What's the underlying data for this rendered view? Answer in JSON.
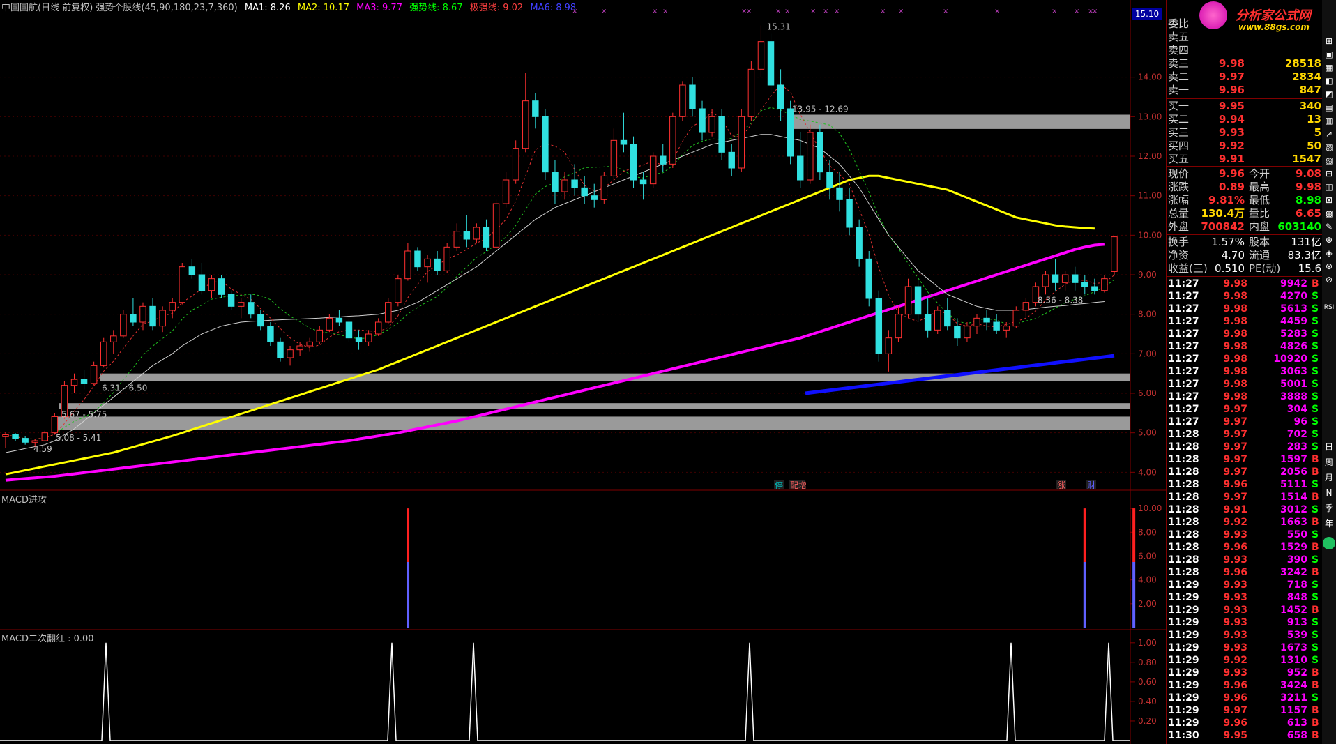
{
  "header": {
    "title": "中国国航(日线 前复权) 强势个股线(45,90,180,23,7,360)",
    "ma1": "MA1: 8.26",
    "ma2": "MA2: 10.17",
    "ma3": "MA3: 9.77",
    "qsx": "强势线: 8.67",
    "jqx": "极强线: 9.02",
    "ma6": "MA6: 8.98",
    "colors": {
      "title": "#c0c0c0",
      "ma1": "#ffffff",
      "ma2": "#ffff00",
      "ma3": "#ff00ff",
      "qsx": "#00ff00",
      "jqx": "#ff4040",
      "ma6": "#0000ff"
    }
  },
  "price_axis": {
    "current_box": "15.10",
    "ticks": [
      "14.00",
      "13.00",
      "12.00",
      "11.00",
      "10.00",
      "9.00",
      "8.00",
      "7.00",
      "6.00",
      "5.00",
      "4.00"
    ]
  },
  "annotations": {
    "high": "15.31",
    "low": "4.59",
    "zone1": "13.95 - 12.69",
    "zone2": "6.31 - 6.50",
    "zone3": "5.67 - 5.75",
    "zone4": "5.08 - 5.41",
    "zone5": "8.36 - 8.38"
  },
  "event_tags": [
    "停",
    "配增",
    "涨",
    "财"
  ],
  "macd_panel": {
    "title": "MACD进攻",
    "ticks": [
      "10.00",
      "8.00",
      "6.00",
      "4.00",
      "2.00"
    ]
  },
  "macd2_panel": {
    "title": "MACD二次翻红 : 0.00",
    "ticks": [
      "1.00",
      "0.80",
      "0.60",
      "0.40",
      "0.20"
    ]
  },
  "logo": {
    "text": "分析家公式网",
    "url": "www.88gs.com"
  },
  "order_book": {
    "weibi": "委比",
    "asks": [
      {
        "label": "卖五",
        "price": "",
        "vol": ""
      },
      {
        "label": "卖四",
        "price": "",
        "vol": ""
      },
      {
        "label": "卖三",
        "price": "9.98",
        "vol": "28518"
      },
      {
        "label": "卖二",
        "price": "9.97",
        "vol": "2834"
      },
      {
        "label": "卖一",
        "price": "9.96",
        "vol": "847"
      }
    ],
    "bids": [
      {
        "label": "买一",
        "price": "9.95",
        "vol": "340"
      },
      {
        "label": "买二",
        "price": "9.94",
        "vol": "13"
      },
      {
        "label": "买三",
        "price": "9.93",
        "vol": "5"
      },
      {
        "label": "买四",
        "price": "9.92",
        "vol": "50"
      },
      {
        "label": "买五",
        "price": "9.91",
        "vol": "1547"
      }
    ]
  },
  "quote": [
    {
      "l1": "现价",
      "v1": "9.96",
      "l2": "今开",
      "v2": "9.08"
    },
    {
      "l1": "涨跌",
      "v1": "0.89",
      "l2": "最高",
      "v2": "9.98"
    },
    {
      "l1": "涨幅",
      "v1": "9.81%",
      "l2": "最低",
      "v2": "8.98"
    },
    {
      "l1": "总量",
      "v1": "130.4万",
      "l2": "量比",
      "v2": "6.65"
    },
    {
      "l1": "外盘",
      "v1": "700842",
      "l2": "内盘",
      "v2": "603140"
    }
  ],
  "fundamentals": [
    {
      "l1": "换手",
      "v1": "1.57%",
      "l2": "股本",
      "v2": "131亿"
    },
    {
      "l1": "净资",
      "v1": "4.70",
      "l2": "流通",
      "v2": "83.3亿"
    },
    {
      "l1": "收益(三)",
      "v1": "0.510",
      "l2": "PE(动)",
      "v2": "15.6"
    }
  ],
  "ticks": [
    [
      "11:27",
      "9.98",
      "9942",
      "B"
    ],
    [
      "11:27",
      "9.98",
      "4270",
      "S"
    ],
    [
      "11:27",
      "9.98",
      "5613",
      "S"
    ],
    [
      "11:27",
      "9.98",
      "4459",
      "S"
    ],
    [
      "11:27",
      "9.98",
      "5283",
      "S"
    ],
    [
      "11:27",
      "9.98",
      "4826",
      "S"
    ],
    [
      "11:27",
      "9.98",
      "10920",
      "S"
    ],
    [
      "11:27",
      "9.98",
      "3063",
      "S"
    ],
    [
      "11:27",
      "9.98",
      "5001",
      "S"
    ],
    [
      "11:27",
      "9.98",
      "3888",
      "S"
    ],
    [
      "11:27",
      "9.97",
      "304",
      "S"
    ],
    [
      "11:27",
      "9.97",
      "96",
      "S"
    ],
    [
      "11:28",
      "9.97",
      "702",
      "S"
    ],
    [
      "11:28",
      "9.97",
      "283",
      "S"
    ],
    [
      "11:28",
      "9.97",
      "1597",
      "B"
    ],
    [
      "11:28",
      "9.97",
      "2056",
      "B"
    ],
    [
      "11:28",
      "9.96",
      "5111",
      "S"
    ],
    [
      "11:28",
      "9.97",
      "1514",
      "B"
    ],
    [
      "11:28",
      "9.91",
      "3012",
      "S"
    ],
    [
      "11:28",
      "9.92",
      "1663",
      "B"
    ],
    [
      "11:28",
      "9.93",
      "550",
      "S"
    ],
    [
      "11:28",
      "9.96",
      "1529",
      "B"
    ],
    [
      "11:28",
      "9.93",
      "390",
      "S"
    ],
    [
      "11:28",
      "9.96",
      "3242",
      "B"
    ],
    [
      "11:29",
      "9.93",
      "718",
      "S"
    ],
    [
      "11:29",
      "9.93",
      "848",
      "S"
    ],
    [
      "11:29",
      "9.93",
      "1452",
      "B"
    ],
    [
      "11:29",
      "9.93",
      "913",
      "S"
    ],
    [
      "11:29",
      "9.93",
      "539",
      "S"
    ],
    [
      "11:29",
      "9.93",
      "1673",
      "S"
    ],
    [
      "11:29",
      "9.92",
      "1310",
      "S"
    ],
    [
      "11:29",
      "9.93",
      "952",
      "B"
    ],
    [
      "11:29",
      "9.96",
      "3424",
      "B"
    ],
    [
      "11:29",
      "9.96",
      "3211",
      "S"
    ],
    [
      "11:29",
      "9.97",
      "1157",
      "B"
    ],
    [
      "11:29",
      "9.96",
      "613",
      "B"
    ],
    [
      "11:30",
      "9.95",
      "658",
      "B"
    ]
  ],
  "sidebar_icons": [
    "日",
    "周",
    "月",
    "N",
    "季",
    "年"
  ],
  "chart_data": {
    "type": "line",
    "title": "中国国航(日线 前复权)",
    "ylim": [
      3.6,
      15.6
    ],
    "candles": [
      [
        4.9,
        5.02,
        4.62,
        4.95
      ],
      [
        4.95,
        4.99,
        4.8,
        4.85
      ],
      [
        4.86,
        4.92,
        4.7,
        4.76
      ],
      [
        4.76,
        4.85,
        4.65,
        4.8
      ],
      [
        4.8,
        5.05,
        4.78,
        5.0
      ],
      [
        5.0,
        5.5,
        4.95,
        5.41
      ],
      [
        5.41,
        6.3,
        5.35,
        6.2
      ],
      [
        6.2,
        6.5,
        6.0,
        6.35
      ],
      [
        6.35,
        6.6,
        6.1,
        6.25
      ],
      [
        6.25,
        6.8,
        6.2,
        6.7
      ],
      [
        6.7,
        7.4,
        6.65,
        7.3
      ],
      [
        7.3,
        7.6,
        7.0,
        7.45
      ],
      [
        7.45,
        8.1,
        7.4,
        8.0
      ],
      [
        8.0,
        8.4,
        7.7,
        7.8
      ],
      [
        7.8,
        8.3,
        7.6,
        8.2
      ],
      [
        8.2,
        8.4,
        7.6,
        7.7
      ],
      [
        7.7,
        8.2,
        7.55,
        8.1
      ],
      [
        8.1,
        8.4,
        7.9,
        8.3
      ],
      [
        8.3,
        9.3,
        8.25,
        9.2
      ],
      [
        9.2,
        9.4,
        8.9,
        9.0
      ],
      [
        9.0,
        9.3,
        8.5,
        8.6
      ],
      [
        8.6,
        9.0,
        8.4,
        8.9
      ],
      [
        8.9,
        9.0,
        8.4,
        8.5
      ],
      [
        8.5,
        8.6,
        8.1,
        8.2
      ],
      [
        8.2,
        8.4,
        7.9,
        8.3
      ],
      [
        8.3,
        8.5,
        7.9,
        8.0
      ],
      [
        8.0,
        8.1,
        7.6,
        7.7
      ],
      [
        7.7,
        7.8,
        7.2,
        7.3
      ],
      [
        7.3,
        7.4,
        6.8,
        6.9
      ],
      [
        6.9,
        7.2,
        6.7,
        7.1
      ],
      [
        7.1,
        7.3,
        6.95,
        7.2
      ],
      [
        7.2,
        7.4,
        7.05,
        7.3
      ],
      [
        7.3,
        7.7,
        7.25,
        7.6
      ],
      [
        7.6,
        8.0,
        7.55,
        7.9
      ],
      [
        7.9,
        8.1,
        7.7,
        7.8
      ],
      [
        7.8,
        7.9,
        7.3,
        7.4
      ],
      [
        7.4,
        7.6,
        7.1,
        7.3
      ],
      [
        7.3,
        7.6,
        7.2,
        7.5
      ],
      [
        7.5,
        7.9,
        7.45,
        7.8
      ],
      [
        7.8,
        8.4,
        7.75,
        8.3
      ],
      [
        8.3,
        9.0,
        8.2,
        8.9
      ],
      [
        8.9,
        9.8,
        8.85,
        9.6
      ],
      [
        9.6,
        9.7,
        9.1,
        9.2
      ],
      [
        9.2,
        9.5,
        8.8,
        9.4
      ],
      [
        9.4,
        9.6,
        9.0,
        9.1
      ],
      [
        9.1,
        9.8,
        9.05,
        9.7
      ],
      [
        9.7,
        10.3,
        9.6,
        10.1
      ],
      [
        10.1,
        10.5,
        9.7,
        9.9
      ],
      [
        9.9,
        10.3,
        9.8,
        10.2
      ],
      [
        10.2,
        10.4,
        9.6,
        9.7
      ],
      [
        9.7,
        10.9,
        9.65,
        10.8
      ],
      [
        10.8,
        11.6,
        10.7,
        11.4
      ],
      [
        11.4,
        12.4,
        11.3,
        12.2
      ],
      [
        12.2,
        14.1,
        12.1,
        13.4
      ],
      [
        13.4,
        13.6,
        12.7,
        13.0
      ],
      [
        13.0,
        13.2,
        11.4,
        11.6
      ],
      [
        11.6,
        11.9,
        10.8,
        11.1
      ],
      [
        11.1,
        11.6,
        10.9,
        11.4
      ],
      [
        11.4,
        11.8,
        11.0,
        11.2
      ],
      [
        11.2,
        11.5,
        10.8,
        11.0
      ],
      [
        11.0,
        11.3,
        10.7,
        10.9
      ],
      [
        10.9,
        11.6,
        10.8,
        11.5
      ],
      [
        11.5,
        12.7,
        11.4,
        12.4
      ],
      [
        12.4,
        13.1,
        12.1,
        12.3
      ],
      [
        12.3,
        12.5,
        11.2,
        11.4
      ],
      [
        11.4,
        11.6,
        10.9,
        11.3
      ],
      [
        11.3,
        12.1,
        11.2,
        12.0
      ],
      [
        12.0,
        12.3,
        11.6,
        11.8
      ],
      [
        11.8,
        13.1,
        11.7,
        13.0
      ],
      [
        13.0,
        13.9,
        12.9,
        13.8
      ],
      [
        13.8,
        14.0,
        13.0,
        13.2
      ],
      [
        13.2,
        13.4,
        12.4,
        12.6
      ],
      [
        12.6,
        13.2,
        12.5,
        13.0
      ],
      [
        13.0,
        13.2,
        11.9,
        12.1
      ],
      [
        12.1,
        12.3,
        11.5,
        11.7
      ],
      [
        11.7,
        13.2,
        11.6,
        13.0
      ],
      [
        13.0,
        14.4,
        12.9,
        14.2
      ],
      [
        14.2,
        15.31,
        14.0,
        14.9
      ],
      [
        14.9,
        15.1,
        13.6,
        13.8
      ],
      [
        13.8,
        14.2,
        12.9,
        13.2
      ],
      [
        13.2,
        13.4,
        11.8,
        12.0
      ],
      [
        12.0,
        12.6,
        11.2,
        11.4
      ],
      [
        11.4,
        12.8,
        11.3,
        12.6
      ],
      [
        12.6,
        12.8,
        11.4,
        11.6
      ],
      [
        11.6,
        11.9,
        10.9,
        11.2
      ],
      [
        11.2,
        11.6,
        10.6,
        10.9
      ],
      [
        10.9,
        11.2,
        10.0,
        10.2
      ],
      [
        10.2,
        10.4,
        9.2,
        9.4
      ],
      [
        9.4,
        9.6,
        8.2,
        8.4
      ],
      [
        8.4,
        8.6,
        6.8,
        7.0
      ],
      [
        7.0,
        7.6,
        6.55,
        7.4
      ],
      [
        7.4,
        8.2,
        7.3,
        8.0
      ],
      [
        8.0,
        8.9,
        7.9,
        8.7
      ],
      [
        8.7,
        8.9,
        7.8,
        8.0
      ],
      [
        8.0,
        8.4,
        7.4,
        7.6
      ],
      [
        7.6,
        8.2,
        7.5,
        8.1
      ],
      [
        8.1,
        8.4,
        7.6,
        7.7
      ],
      [
        7.7,
        7.9,
        7.2,
        7.4
      ],
      [
        7.4,
        7.8,
        7.3,
        7.7
      ],
      [
        7.7,
        8.0,
        7.5,
        7.9
      ],
      [
        7.9,
        8.1,
        7.6,
        7.8
      ],
      [
        7.8,
        8.0,
        7.5,
        7.6
      ],
      [
        7.6,
        7.8,
        7.4,
        7.7
      ],
      [
        7.7,
        8.2,
        7.65,
        8.1
      ],
      [
        8.1,
        8.4,
        7.9,
        8.3
      ],
      [
        8.3,
        8.8,
        8.2,
        8.7
      ],
      [
        8.7,
        9.1,
        8.5,
        9.0
      ],
      [
        9.0,
        9.4,
        8.6,
        8.8
      ],
      [
        8.8,
        9.1,
        8.6,
        9.0
      ],
      [
        9.0,
        9.2,
        8.6,
        8.8
      ],
      [
        8.8,
        9.0,
        8.5,
        8.7
      ],
      [
        8.7,
        8.9,
        8.5,
        8.6
      ],
      [
        8.6,
        9.0,
        8.55,
        8.9
      ],
      [
        9.08,
        9.98,
        8.98,
        9.96
      ]
    ],
    "ma_white": [
      4.5,
      4.55,
      4.6,
      4.65,
      4.7,
      4.8,
      4.95,
      5.1,
      5.3,
      5.5,
      5.7,
      5.9,
      6.1,
      6.3,
      6.5,
      6.7,
      6.85,
      7.0,
      7.2,
      7.35,
      7.5,
      7.6,
      7.7,
      7.75,
      7.8,
      7.82,
      7.83,
      7.85,
      7.86,
      7.87,
      7.88,
      7.89,
      7.9,
      7.92,
      7.93,
      7.95,
      7.96,
      7.98,
      8.0,
      8.05,
      8.1,
      8.2,
      8.3,
      8.45,
      8.6,
      8.75,
      8.9,
      9.05,
      9.2,
      9.4,
      9.6,
      9.8,
      10.0,
      10.2,
      10.4,
      10.55,
      10.7,
      10.8,
      10.9,
      11.0,
      11.1,
      11.2,
      11.3,
      11.4,
      11.5,
      11.6,
      11.7,
      11.8,
      11.9,
      12.0,
      12.1,
      12.2,
      12.3,
      12.35,
      12.4,
      12.45,
      12.5,
      12.55,
      12.55,
      12.5,
      12.45,
      12.4,
      12.3,
      12.2,
      12.0,
      11.8,
      11.5,
      11.2,
      10.8,
      10.4,
      10.0,
      9.7,
      9.4,
      9.1,
      8.9,
      8.7,
      8.5,
      8.4,
      8.3,
      8.2,
      8.15,
      8.1,
      8.1,
      8.1,
      8.12,
      8.15,
      8.18,
      8.2,
      8.22,
      8.25,
      8.27,
      8.3,
      8.32
    ],
    "ma_yellow": [
      3.95,
      4.0,
      4.05,
      4.1,
      4.15,
      4.2,
      4.25,
      4.3,
      4.35,
      4.4,
      4.45,
      4.5,
      4.57,
      4.64,
      4.71,
      4.78,
      4.85,
      4.92,
      5.0,
      5.08,
      5.16,
      5.24,
      5.32,
      5.4,
      5.48,
      5.56,
      5.64,
      5.72,
      5.8,
      5.88,
      5.96,
      6.04,
      6.12,
      6.2,
      6.28,
      6.36,
      6.44,
      6.52,
      6.6,
      6.7,
      6.8,
      6.9,
      7.0,
      7.1,
      7.2,
      7.3,
      7.4,
      7.5,
      7.6,
      7.7,
      7.8,
      7.9,
      8.0,
      8.1,
      8.2,
      8.3,
      8.4,
      8.5,
      8.6,
      8.7,
      8.8,
      8.9,
      9.0,
      9.1,
      9.2,
      9.3,
      9.4,
      9.5,
      9.6,
      9.7,
      9.8,
      9.9,
      10.0,
      10.1,
      10.2,
      10.3,
      10.4,
      10.5,
      10.6,
      10.7,
      10.8,
      10.9,
      11.0,
      11.1,
      11.2,
      11.3,
      11.4,
      11.45,
      11.5,
      11.5,
      11.45,
      11.4,
      11.35,
      11.3,
      11.25,
      11.2,
      11.15,
      11.05,
      10.95,
      10.85,
      10.75,
      10.65,
      10.55,
      10.45,
      10.4,
      10.35,
      10.3,
      10.25,
      10.22,
      10.2,
      10.18,
      10.17
    ],
    "ma_magenta": [
      3.8,
      3.82,
      3.84,
      3.86,
      3.88,
      3.9,
      3.93,
      3.96,
      3.99,
      4.02,
      4.05,
      4.08,
      4.11,
      4.14,
      4.17,
      4.2,
      4.23,
      4.26,
      4.29,
      4.32,
      4.35,
      4.38,
      4.41,
      4.44,
      4.47,
      4.5,
      4.53,
      4.56,
      4.59,
      4.62,
      4.65,
      4.68,
      4.71,
      4.74,
      4.77,
      4.8,
      4.84,
      4.88,
      4.92,
      4.96,
      5.0,
      5.05,
      5.1,
      5.15,
      5.2,
      5.25,
      5.3,
      5.36,
      5.42,
      5.48,
      5.54,
      5.6,
      5.66,
      5.72,
      5.78,
      5.84,
      5.9,
      5.96,
      6.02,
      6.08,
      6.14,
      6.2,
      6.26,
      6.32,
      6.38,
      6.44,
      6.5,
      6.56,
      6.62,
      6.68,
      6.74,
      6.8,
      6.86,
      6.92,
      6.98,
      7.04,
      7.1,
      7.16,
      7.22,
      7.28,
      7.34,
      7.4,
      7.48,
      7.56,
      7.64,
      7.72,
      7.8,
      7.88,
      7.96,
      8.04,
      8.12,
      8.2,
      8.28,
      8.36,
      8.44,
      8.52,
      8.6,
      8.68,
      8.76,
      8.84,
      8.92,
      9.0,
      9.08,
      9.16,
      9.24,
      9.32,
      9.4,
      9.48,
      9.56,
      9.64,
      9.7,
      9.75,
      9.77
    ],
    "macd_signals": [
      {
        "index": 43,
        "value": 10.0
      },
      {
        "index": 110,
        "value": 10.0
      },
      {
        "index": 115,
        "value": 10.0
      }
    ],
    "macd2_signals": [
      10,
      38,
      47,
      75,
      101,
      112
    ]
  }
}
